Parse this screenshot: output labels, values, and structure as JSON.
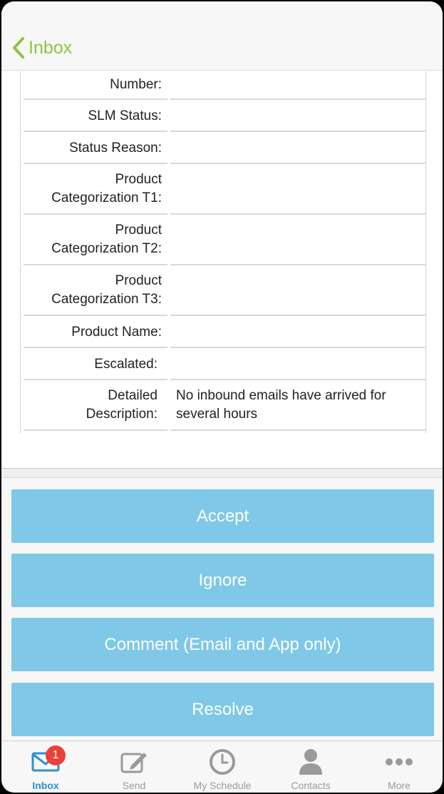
{
  "nav": {
    "back_label": "Inbox"
  },
  "details": {
    "rows": [
      {
        "label": "Number:",
        "value": ""
      },
      {
        "label": "SLM Status:",
        "value": ""
      },
      {
        "label": "Status Reason:",
        "value": ""
      },
      {
        "label": "Product\nCategorization T1:",
        "value": ""
      },
      {
        "label": "Product\nCategorization T2:",
        "value": ""
      },
      {
        "label": "Product\nCategorization T3:",
        "value": ""
      },
      {
        "label": "Product Name:",
        "value": ""
      },
      {
        "label": "Escalated:",
        "value": ""
      },
      {
        "label": "Detailed\nDescription:",
        "value": "No inbound emails have arrived for several hours"
      }
    ]
  },
  "actions": {
    "accept": "Accept",
    "ignore": "Ignore",
    "comment": "Comment (Email and App only)",
    "resolve": "Resolve"
  },
  "tabbar": {
    "accent_color": "#2e8fd0",
    "tabs": [
      {
        "label": "Inbox",
        "icon": "envelope-icon",
        "badge": "1",
        "active": true
      },
      {
        "label": "Send",
        "icon": "compose-icon"
      },
      {
        "label": "My Schedule",
        "icon": "clock-icon"
      },
      {
        "label": "Contacts",
        "icon": "person-icon"
      },
      {
        "label": "More",
        "icon": "more-dots-icon"
      }
    ]
  }
}
